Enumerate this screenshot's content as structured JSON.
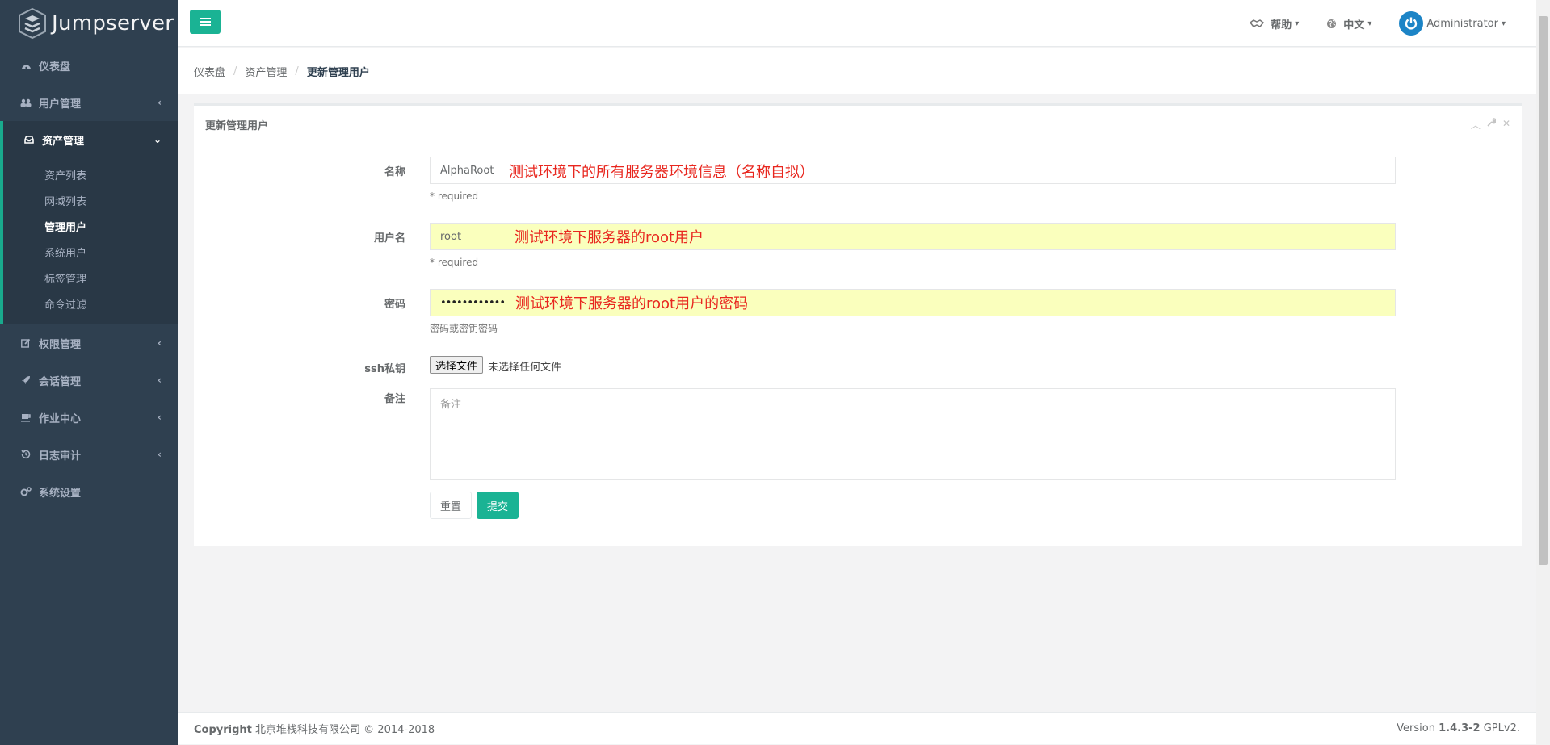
{
  "brand": {
    "name": "Jumpserver",
    "accent": "#1ab394",
    "sidebar_bg": "#2f4050"
  },
  "sidebar": {
    "items": [
      {
        "label": "仪表盘",
        "icon": "dashboard-icon"
      },
      {
        "label": "用户管理",
        "icon": "users-icon"
      },
      {
        "label": "资产管理",
        "icon": "inbox-icon",
        "expanded": true,
        "children": [
          "资产列表",
          "网域列表",
          "管理用户",
          "系统用户",
          "标签管理",
          "命令过滤"
        ],
        "current": "管理用户"
      },
      {
        "label": "权限管理",
        "icon": "edit-icon"
      },
      {
        "label": "会话管理",
        "icon": "rocket-icon"
      },
      {
        "label": "作业中心",
        "icon": "coffee-icon"
      },
      {
        "label": "日志审计",
        "icon": "history-icon"
      },
      {
        "label": "系统设置",
        "icon": "gears-icon"
      }
    ]
  },
  "topbar": {
    "help_label": "帮助",
    "lang_label": "中文",
    "user_label": "Administrator"
  },
  "breadcrumb": [
    "仪表盘",
    "资产管理",
    "更新管理用户"
  ],
  "panel": {
    "title": "更新管理用户",
    "form": {
      "name_label": "名称",
      "name_value": "AlphaRoot",
      "name_annotation": "测试环境下的所有服务器环境信息（名称自拟）",
      "required_text": "* required",
      "username_label": "用户名",
      "username_value": "root",
      "username_annotation": "测试环境下服务器的root用户",
      "password_label": "密码",
      "password_value": "••••••••••••",
      "password_annotation": "测试环境下服务器的root用户的密码",
      "password_help": "密码或密钥密码",
      "ssh_label": "ssh私钥",
      "file_button": "选择文件",
      "file_status": "未选择任何文件",
      "comment_label": "备注",
      "comment_placeholder": "备注",
      "reset_label": "重置",
      "submit_label": "提交"
    }
  },
  "footer": {
    "copyright_strong": "Copyright",
    "copyright_text": "北京堆栈科技有限公司 © 2014-2018",
    "version_prefix": "Version",
    "version_number": "1.4.3-2",
    "version_suffix": "GPLv2."
  }
}
